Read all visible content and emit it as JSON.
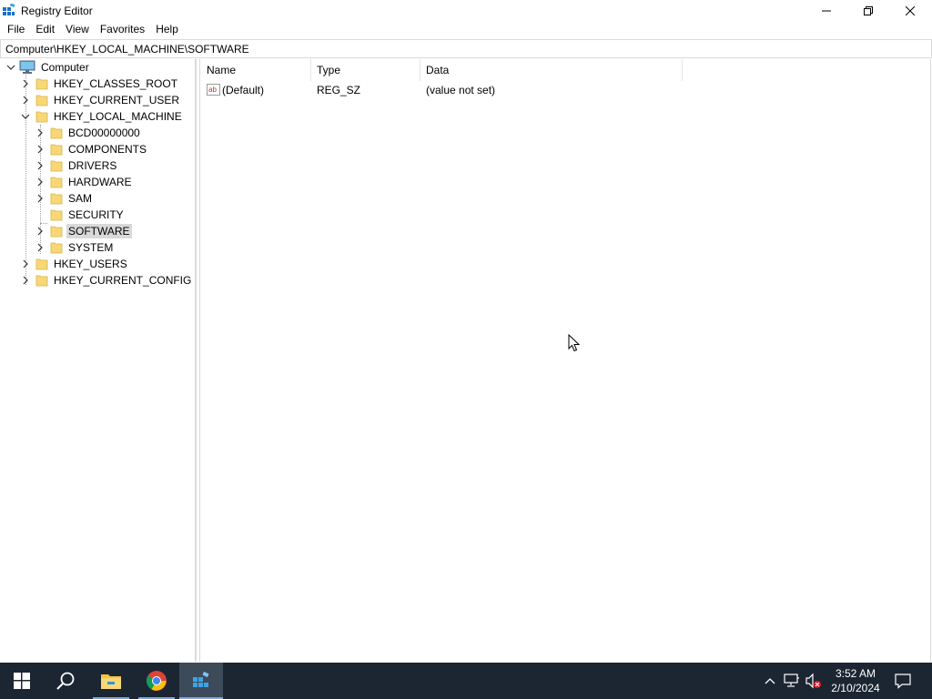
{
  "window": {
    "title": "Registry Editor"
  },
  "menu": {
    "items": [
      "File",
      "Edit",
      "View",
      "Favorites",
      "Help"
    ]
  },
  "address": {
    "path": "Computer\\HKEY_LOCAL_MACHINE\\SOFTWARE"
  },
  "tree": {
    "root": "Computer",
    "hives": [
      {
        "label": "HKEY_CLASSES_ROOT",
        "expanded": false
      },
      {
        "label": "HKEY_CURRENT_USER",
        "expanded": false
      },
      {
        "label": "HKEY_LOCAL_MACHINE",
        "expanded": true
      },
      {
        "label": "HKEY_USERS",
        "expanded": false
      },
      {
        "label": "HKEY_CURRENT_CONFIG",
        "expanded": false
      }
    ],
    "hklm_children": [
      {
        "label": "BCD00000000",
        "has_children": true
      },
      {
        "label": "COMPONENTS",
        "has_children": true
      },
      {
        "label": "DRIVERS",
        "has_children": true
      },
      {
        "label": "HARDWARE",
        "has_children": true
      },
      {
        "label": "SAM",
        "has_children": true
      },
      {
        "label": "SECURITY",
        "has_children": false
      },
      {
        "label": "SOFTWARE",
        "has_children": true,
        "selected": true
      },
      {
        "label": "SYSTEM",
        "has_children": true
      }
    ]
  },
  "list": {
    "columns": [
      "Name",
      "Type",
      "Data"
    ],
    "rows": [
      {
        "name": "(Default)",
        "type": "REG_SZ",
        "data": "(value not set)",
        "icon": "string-value-icon"
      }
    ]
  },
  "taskbar": {
    "apps": [
      "start-icon",
      "search-icon",
      "file-explorer-icon",
      "chrome-icon",
      "registry-editor-icon"
    ],
    "active_app": "registry-editor-icon",
    "time": "3:52 AM",
    "date": "2/10/2024"
  },
  "colors": {
    "taskbar_bg": "#1c2633",
    "selection_bg": "#d9d9d9",
    "folder_yellow": "#f8d775"
  }
}
